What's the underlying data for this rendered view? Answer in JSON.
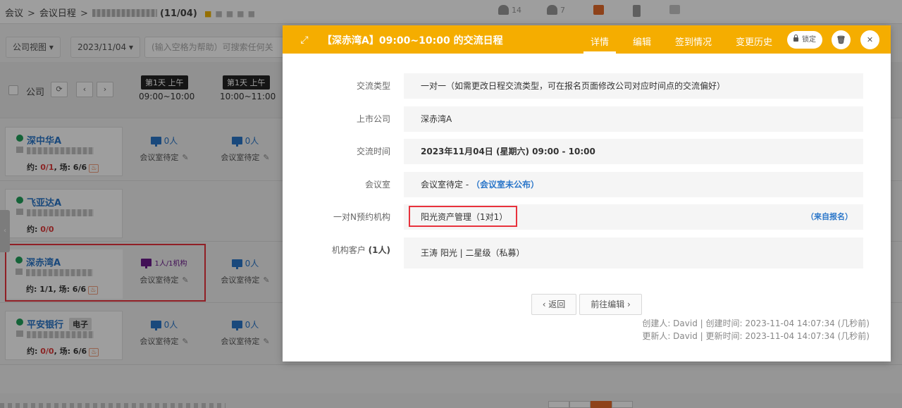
{
  "breadcrumb": {
    "item1": "会议",
    "item2": "会议日程",
    "count": "(11/04)"
  },
  "top_stats": {
    "people": "14",
    "groups": "7"
  },
  "toolbar": {
    "view": "公司视图 ▾",
    "date": "2023/11/04 ▾",
    "search_placeholder": "(输入空格为帮助）可搜索任何关"
  },
  "grid": {
    "company_label": "公司",
    "slots": [
      {
        "day": "第1天 上午",
        "time": "09:00~10:00"
      },
      {
        "day": "第1天 上午",
        "time": "10:00~11:00"
      }
    ],
    "rows": [
      {
        "name": "深中华A",
        "tag": "",
        "stat_prefix": "约: ",
        "stat_value": "0/1",
        "stat_rest": ", 场: 6/6",
        "cells": [
          {
            "count": "0人",
            "room": "会议室待定"
          },
          {
            "count": "0人",
            "room": "会议室待定"
          }
        ]
      },
      {
        "name": "飞亚达A",
        "tag": "",
        "stat_prefix": "约: ",
        "stat_value": "0/0",
        "stat_rest": "",
        "cells": []
      },
      {
        "name": "深赤湾A",
        "tag": "",
        "stat_prefix": "约: ",
        "stat_value": "1/1",
        "stat_rest": ", 场: 6/6",
        "cells": [
          {
            "count": "1人/1机构",
            "room": "会议室待定"
          },
          {
            "count": "0人",
            "room": "会议室待定"
          }
        ]
      },
      {
        "name": "平安银行",
        "tag": "电子",
        "stat_prefix": "约: ",
        "stat_value": "0/0",
        "stat_rest": ", 场: 6/6",
        "cells": [
          {
            "count": "0人",
            "room": "会议室待定"
          },
          {
            "count": "0人",
            "room": "会议室待定"
          }
        ]
      }
    ]
  },
  "modal": {
    "title": "【深赤湾A】09:00~10:00 的交流日程",
    "tabs": [
      "详情",
      "编辑",
      "签到情况",
      "变更历史"
    ],
    "lock_label": "锁定",
    "fields": {
      "type_label": "交流类型",
      "type_value": "一对一（如需更改日程交流类型，可在报名页面修改公司对应时间点的交流偏好）",
      "company_label": "上市公司",
      "company_value": "深赤湾A",
      "time_label": "交流时间",
      "time_value": "2023年11月04日 (星期六)  09:00 - 10:00",
      "room_label": "会议室",
      "room_value": "会议室待定 - ",
      "room_link": "（会议室未公布）",
      "org_label": "一对N预约机构",
      "org_value": "阳光资产管理（1对1）",
      "org_source": "（来自报名）",
      "client_label": "机构客户 ",
      "client_count": "(1人)",
      "client_value": "王涛 阳光 | 二星级（私募）"
    },
    "back_label": "‹  返回",
    "edit_label": "前往编辑  ›",
    "creator": "创建人: David | 创建时间: 2023-11-04 14:07:34 (几秒前)",
    "updater": "更新人: David | 更新时间: 2023-11-04 14:07:34 (几秒前)"
  },
  "colors": {
    "accent": "#f5ad00",
    "link": "#2a76c9",
    "highlight": "#e8323c"
  }
}
